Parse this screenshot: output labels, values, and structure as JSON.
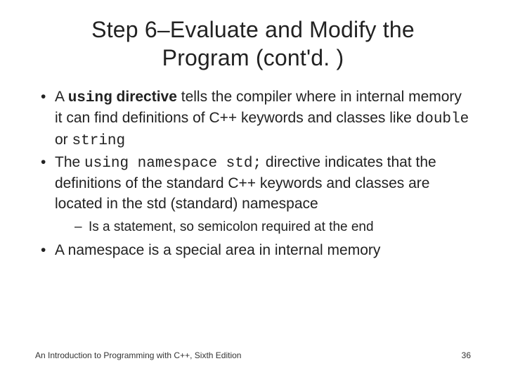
{
  "title_line1": "Step 6–Evaluate and Modify the",
  "title_line2": "Program (cont'd. )",
  "bullets": {
    "b1_p1": "A ",
    "b1_code1": "using",
    "b1_p2": " directive",
    "b1_p3": " tells the compiler where in internal memory it can find definitions of C++ keywords and classes like ",
    "b1_code2": "double",
    "b1_p4": " or ",
    "b1_code3": "string",
    "b2_p1": "The ",
    "b2_code1": "using namespace std;",
    "b2_p2": " directive indicates that the definitions of the standard C++ keywords and classes are located in the std (standard) namespace",
    "b2_sub1": "Is a statement, so semicolon required at the end",
    "b3": "A namespace is a special area in internal memory"
  },
  "footer_left": "An Introduction to Programming with C++, Sixth Edition",
  "footer_right": "36"
}
